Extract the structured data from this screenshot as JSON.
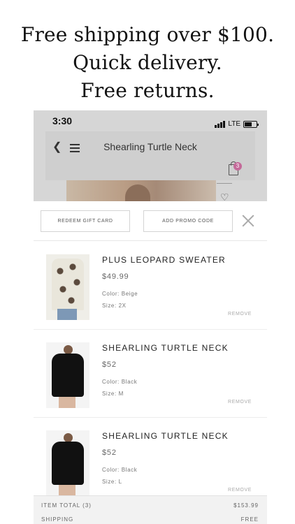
{
  "headline": {
    "line1": "Free shipping over $100.",
    "line2": "Quick delivery.",
    "line3": "Free returns."
  },
  "status_bar": {
    "time": "3:30",
    "network": "LTE"
  },
  "nav": {
    "title": "Shearling Turtle Neck",
    "cart_count": "3"
  },
  "promo": {
    "redeem_label": "REDEEM GIFT CARD",
    "promo_label": "ADD PROMO CODE"
  },
  "cart_items": [
    {
      "name": "PLUS LEOPARD SWEATER",
      "price": "$49.99",
      "color": "Color: Beige",
      "size": "Size: 2X",
      "remove": "REMOVE"
    },
    {
      "name": "SHEARLING TURTLE NECK",
      "price": "$52",
      "color": "Color: Black",
      "size": "Size: M",
      "remove": "REMOVE"
    },
    {
      "name": "SHEARLING TURTLE NECK",
      "price": "$52",
      "color": "Color: Black",
      "size": "Size: L",
      "remove": "REMOVE"
    }
  ],
  "totals": {
    "item_total_label": "ITEM TOTAL (3)",
    "item_total_value": "$153.99",
    "shipping_label": "SHIPPING",
    "shipping_value": "FREE"
  },
  "colors": {
    "badge": "#c46a9a",
    "overlay": "#d6d6d6"
  }
}
